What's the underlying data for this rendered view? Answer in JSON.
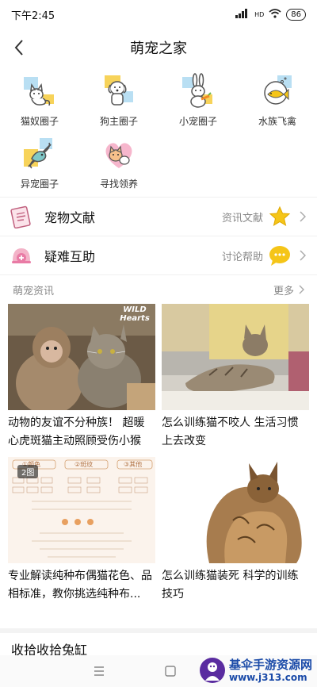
{
  "status_bar": {
    "time": "下午2:45",
    "network": "HD",
    "battery": "86"
  },
  "header": {
    "title": "萌宠之家"
  },
  "categories": [
    {
      "label": "猫奴圈子",
      "icon": "cat-icon"
    },
    {
      "label": "狗主圈子",
      "icon": "dog-icon"
    },
    {
      "label": "小宠圈子",
      "icon": "rabbit-icon"
    },
    {
      "label": "水族飞禽",
      "icon": "fish-icon"
    },
    {
      "label": "异宠圈子",
      "icon": "chameleon-icon"
    },
    {
      "label": "寻找领养",
      "icon": "cat-heart-icon"
    }
  ],
  "rows": [
    {
      "title": "宠物文献",
      "sub": "资讯文献",
      "icon": "document-icon",
      "bubble": "star-icon"
    },
    {
      "title": "疑难互助",
      "sub": "讨论帮助",
      "icon": "help-icon",
      "bubble": "chat-bubble-icon"
    }
  ],
  "news": {
    "title": "萌宠资讯",
    "more": "更多",
    "items": [
      {
        "caption": "动物的友谊不分种族！ 超暖心虎斑猫主动照顾受伤小猴",
        "overlay": "WILD Hearts"
      },
      {
        "caption": "怎么训练猫不咬人 生活习惯上去改变"
      },
      {
        "caption": "专业解读纯种布偶猫花色、品相标准，教你挑选纯种布...",
        "badge": "2图",
        "chart_labels": [
          "①颜色",
          "②斑纹",
          "③其他"
        ]
      },
      {
        "caption": "怎么训练猫装死 科学的训练技巧"
      }
    ]
  },
  "bottom": {
    "title": "收拾收拾兔缸"
  },
  "watermark": {
    "text": "基伞手游资源网",
    "url": "www.j313.com"
  },
  "colors": {
    "accent_yellow": "#f5c518",
    "pink": "#e97ba5",
    "watermark_blue": "#1a4aa8"
  }
}
